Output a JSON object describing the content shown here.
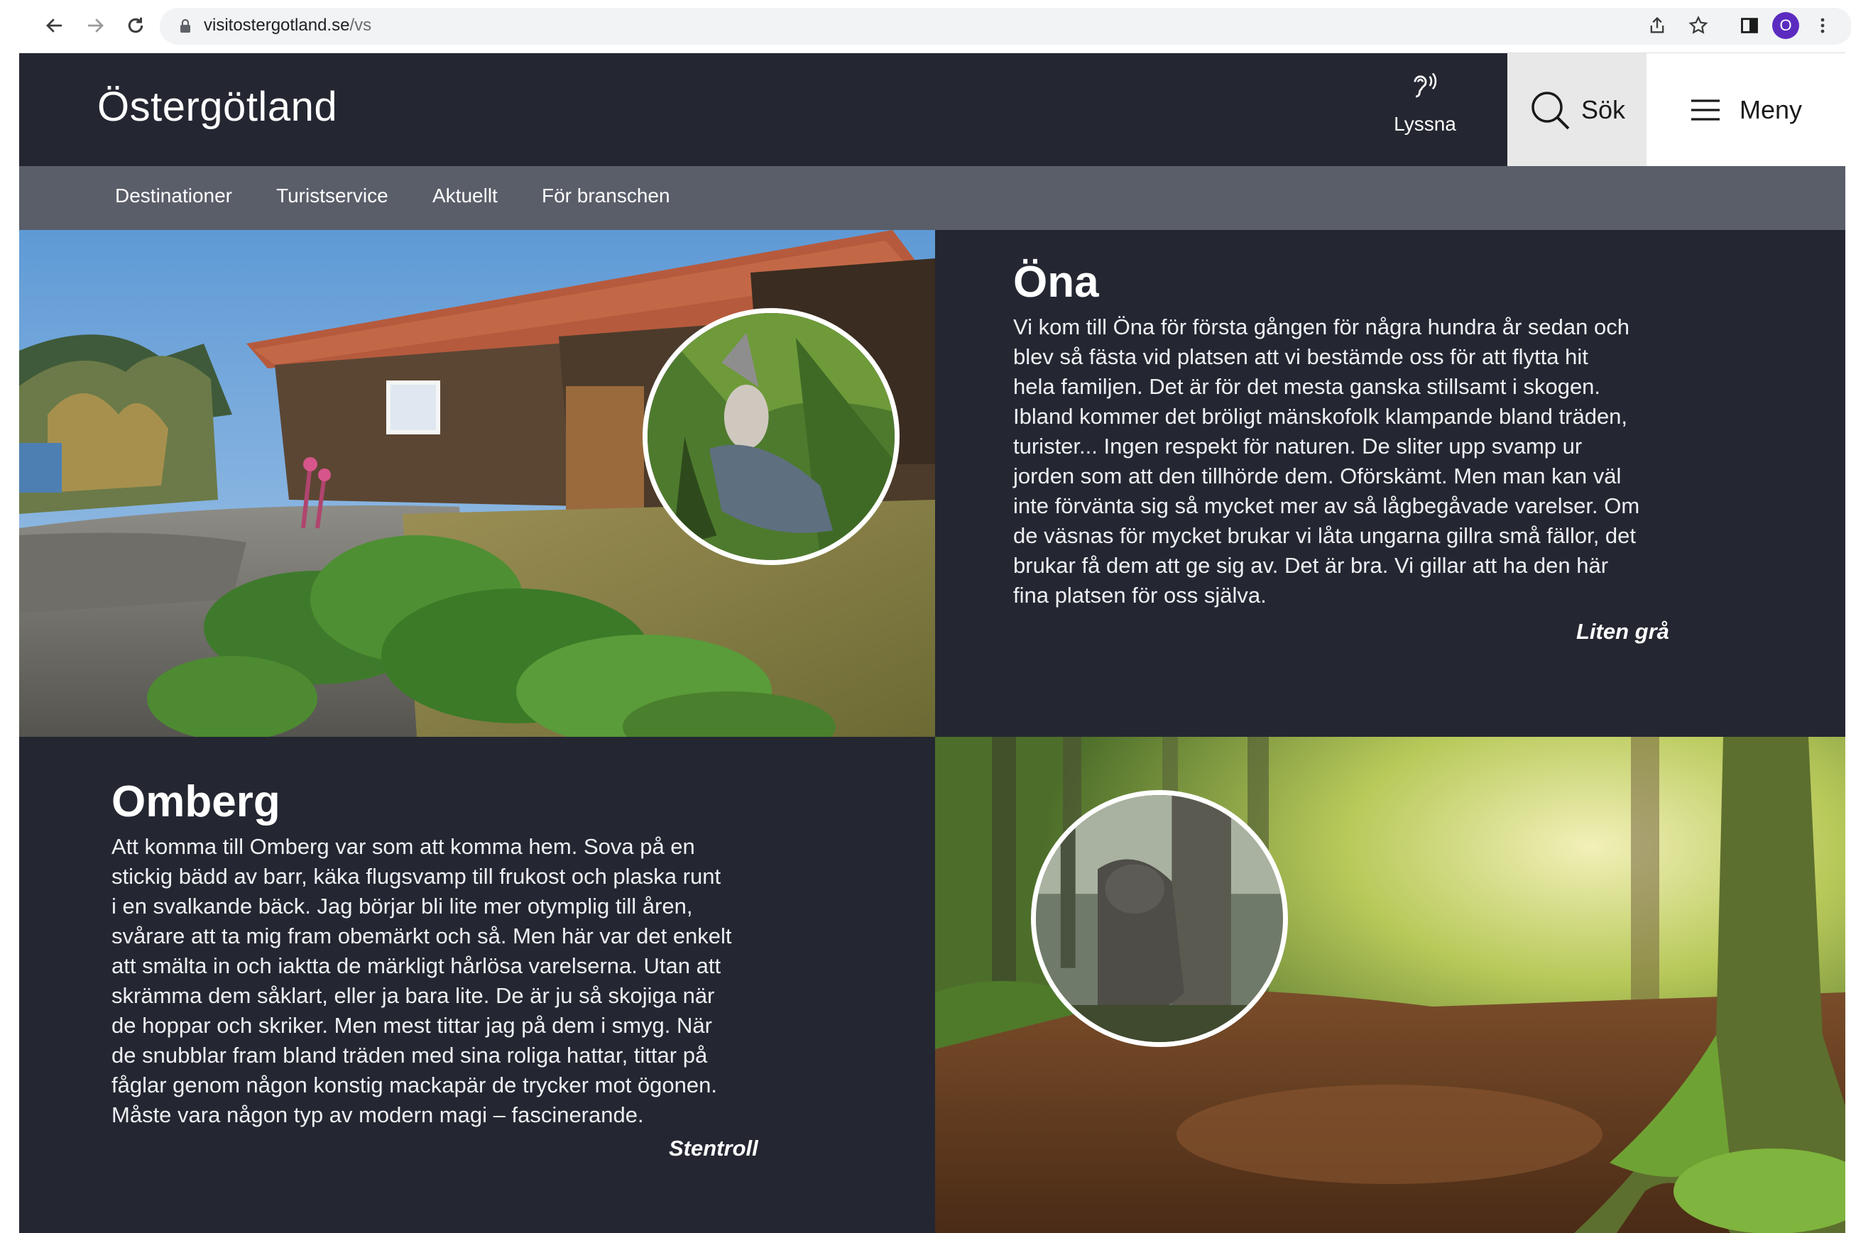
{
  "browser": {
    "url_domain": "visitostergotland.se",
    "url_path": "/vs",
    "back_icon": "arrow-left-icon",
    "forward_icon": "arrow-right-icon",
    "reload_icon": "reload-icon",
    "profile_initial": "O",
    "profile_color": "#5b2bc0"
  },
  "header": {
    "logo": "Östergötland",
    "listen_label": "Lyssna",
    "search_label": "Sök",
    "menu_label": "Meny",
    "bg_color": "#242731"
  },
  "subnav": {
    "items": [
      {
        "label": "Destinationer"
      },
      {
        "label": "Turistservice"
      },
      {
        "label": "Aktuellt"
      },
      {
        "label": "För branschen"
      }
    ],
    "bg_color": "#5a5e69"
  },
  "sections": [
    {
      "title": "Öna",
      "lines": [
        "Vi kom till Öna för första gången för några hundra år sedan och",
        "blev så fästa vid platsen att vi bestämde oss för att flytta hit",
        "hela familjen. Det är för det mesta ganska stillsamt i skogen.",
        "Ibland kommer det bröligt mänskofolk klampande bland träden,",
        "turister... Ingen respekt för naturen. De sliter upp svamp ur",
        "jorden som att den tillhörde dem. Oförskämt. Men man kan väl",
        "inte förvänta sig så mycket mer av så lågbegåvade varelser. Om",
        "de väsnas för mycket brukar vi låta ungarna gillra små fällor, det",
        "brukar få dem att ge sig av. Det är bra. Vi gillar att ha den här",
        "fina platsen för oss själva."
      ],
      "signature": "Liten grå"
    },
    {
      "title": "Omberg",
      "lines": [
        "Att komma till Omberg var som att komma hem. Sova på en",
        "stickig bädd av barr, käka flugsvamp till frukost och plaska runt",
        "i en svalkande bäck. Jag börjar bli lite mer otymplig till åren,",
        "svårare att ta mig fram obemärkt och så. Men här var det enkelt",
        "att smälta in och iaktta de märkligt hårlösa varelserna. Utan att",
        "skrämma dem såklart, eller ja bara lite. De är ju så skojiga när",
        "de hoppar och skriker. Men mest tittar jag på dem i smyg. När",
        "de snubblar fram bland träden med sina roliga hattar, tittar på",
        "fåglar genom någon konstig mackapär de trycker mot ögonen.",
        "Måste vara någon typ av modern magi – fascinerande."
      ],
      "signature": "Stentroll"
    }
  ]
}
